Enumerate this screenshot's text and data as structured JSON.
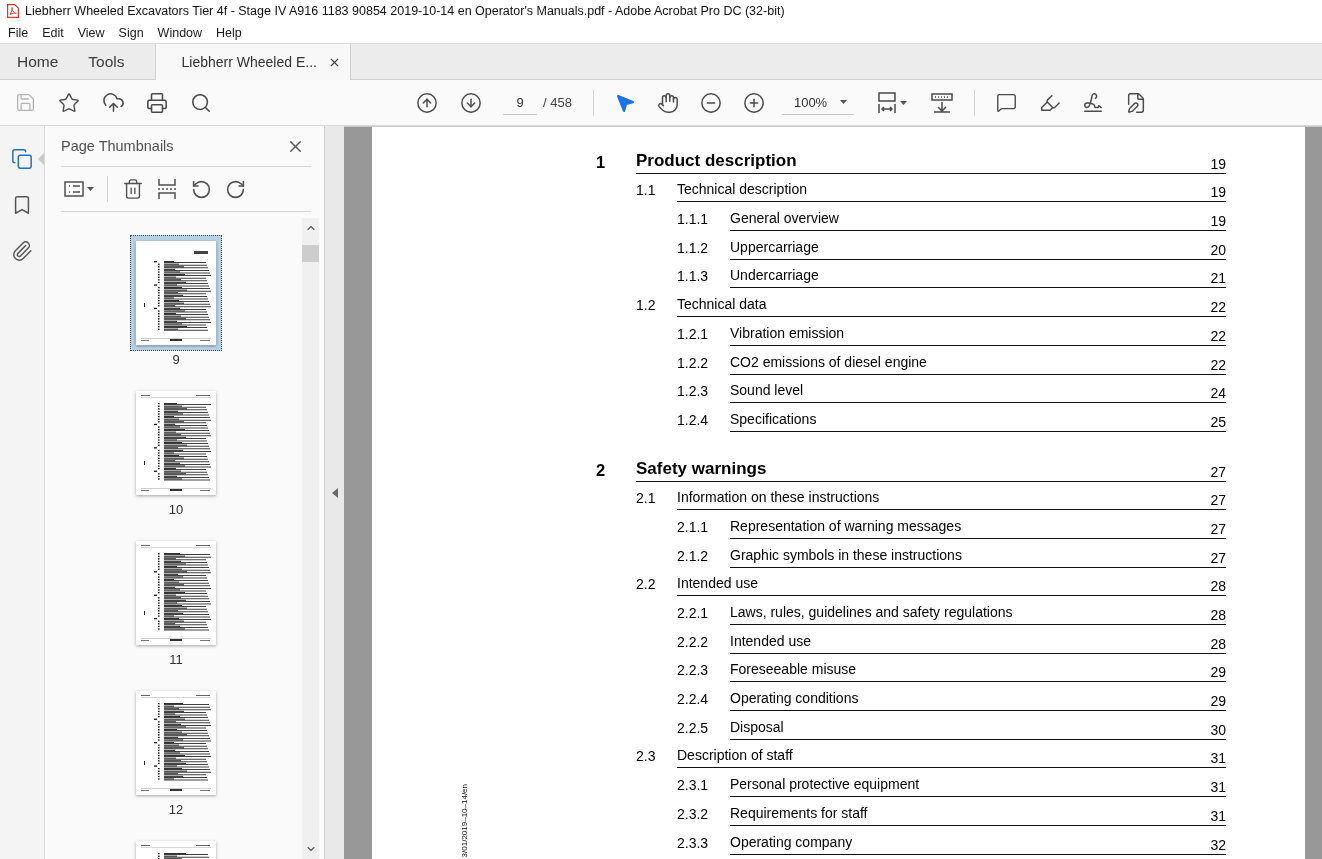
{
  "window": {
    "title": "Liebherr Wheeled Excavators Tier 4f - Stage IV A916 1183 90854 2019-10-14 en Operator's Manuals.pdf - Adobe Acrobat Pro DC (32-bit)"
  },
  "menu_bar": [
    {
      "label": "File"
    },
    {
      "label": "Edit"
    },
    {
      "label": "View"
    },
    {
      "label": "Sign"
    },
    {
      "label": "Window"
    },
    {
      "label": "Help"
    }
  ],
  "tabs": [
    {
      "label": "Home",
      "kind": "nav",
      "selected": false
    },
    {
      "label": "Tools",
      "kind": "nav",
      "selected": false
    },
    {
      "label": "Liebherr Wheeled E...",
      "kind": "document",
      "selected": true
    }
  ],
  "toolbar": {
    "save_disabled": true,
    "page_field": {
      "value": "9"
    },
    "page_count": "/ 458",
    "modes": [
      {
        "kind": "select",
        "selected": true
      },
      {
        "kind": "hand",
        "selected": false
      }
    ],
    "zoom_field": {
      "value": "100%"
    }
  },
  "side_rail": [
    {
      "kind": "pages",
      "selected": true
    },
    {
      "kind": "bookmarks",
      "selected": false
    },
    {
      "kind": "attachments",
      "selected": false
    }
  ],
  "thumbnails_panel": {
    "title": "Page Thumbnails",
    "thumbnails": [
      {
        "label": "9",
        "selected": true
      },
      {
        "label": "10",
        "selected": false
      },
      {
        "label": "11",
        "selected": false
      },
      {
        "label": "12",
        "selected": false
      },
      {
        "selected": false
      }
    ]
  },
  "document": {
    "toc": [
      {
        "number": "1",
        "title": "Product description",
        "page": "19",
        "children": [
          {
            "number": "1.1",
            "title": "Technical description",
            "page": "19",
            "children": [
              {
                "number": "1.1.1",
                "title": "General overview",
                "page": "19"
              },
              {
                "number": "1.1.2",
                "title": "Uppercarriage",
                "page": "20"
              },
              {
                "number": "1.1.3",
                "title": "Undercarriage",
                "page": "21"
              }
            ]
          },
          {
            "number": "1.2",
            "title": "Technical data",
            "page": "22",
            "children": [
              {
                "number": "1.2.1",
                "title": "Vibration emission",
                "page": "22"
              },
              {
                "number": "1.2.2",
                "title": "CO2 emissions of diesel engine",
                "page": "22"
              },
              {
                "number": "1.2.3",
                "title": "Sound level",
                "page": "24"
              },
              {
                "number": "1.2.4",
                "title": "Specifications",
                "page": "25"
              }
            ]
          }
        ]
      },
      {
        "number": "2",
        "title": "Safety warnings",
        "page": "27",
        "children": [
          {
            "number": "2.1",
            "title": "Information on these instructions",
            "page": "27",
            "children": [
              {
                "number": "2.1.1",
                "title": "Representation of warning messages",
                "page": "27"
              },
              {
                "number": "2.1.2",
                "title": "Graphic symbols in these instructions",
                "page": "27"
              }
            ]
          },
          {
            "number": "2.2",
            "title": "Intended use",
            "page": "28",
            "children": [
              {
                "number": "2.2.1",
                "title": "Laws, rules, guidelines and safety regulations",
                "page": "28"
              },
              {
                "number": "2.2.2",
                "title": "Intended use",
                "page": "28"
              },
              {
                "number": "2.2.3",
                "title": "Foreseeable misuse",
                "page": "29"
              },
              {
                "number": "2.2.4",
                "title": "Operating conditions",
                "page": "29"
              },
              {
                "number": "2.2.5",
                "title": "Disposal",
                "page": "30"
              }
            ]
          },
          {
            "number": "2.3",
            "title": "Description of staff",
            "page": "31",
            "children": [
              {
                "number": "2.3.1",
                "title": "Personal protective equipment",
                "page": "31"
              },
              {
                "number": "2.3.2",
                "title": "Requirements for staff",
                "page": "31"
              },
              {
                "number": "2.3.3",
                "title": "Operating company",
                "page": "32"
              }
            ]
          }
        ]
      }
    ],
    "margin_note": "3/01/2019–10–14/en"
  }
}
